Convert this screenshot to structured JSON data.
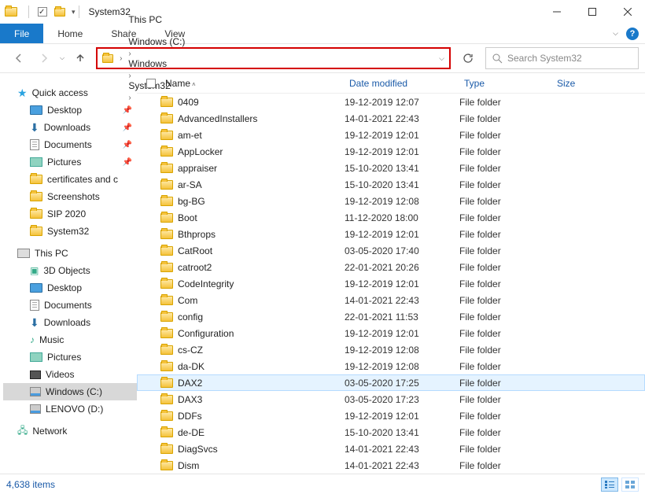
{
  "title": "System32",
  "ribbon": {
    "file": "File",
    "home": "Home",
    "share": "Share",
    "view": "View"
  },
  "breadcrumb": [
    "This PC",
    "Windows (C:)",
    "Windows",
    "System32"
  ],
  "search": {
    "placeholder": "Search System32"
  },
  "columns": {
    "name": "Name",
    "date": "Date modified",
    "type": "Type",
    "size": "Size"
  },
  "tree": {
    "quick": "Quick access",
    "quick_items": [
      {
        "label": "Desktop",
        "icon": "desktop",
        "pin": true
      },
      {
        "label": "Downloads",
        "icon": "download",
        "pin": true
      },
      {
        "label": "Documents",
        "icon": "doc",
        "pin": true
      },
      {
        "label": "Pictures",
        "icon": "pic",
        "pin": true
      },
      {
        "label": "certificates and c",
        "icon": "folder",
        "pin": false
      },
      {
        "label": "Screenshots",
        "icon": "folder",
        "pin": false
      },
      {
        "label": "SIP 2020",
        "icon": "folder",
        "pin": false
      },
      {
        "label": "System32",
        "icon": "folder",
        "pin": false
      }
    ],
    "thispc": "This PC",
    "pc_items": [
      {
        "label": "3D Objects",
        "icon": "3d"
      },
      {
        "label": "Desktop",
        "icon": "desktop"
      },
      {
        "label": "Documents",
        "icon": "doc"
      },
      {
        "label": "Downloads",
        "icon": "download"
      },
      {
        "label": "Music",
        "icon": "music"
      },
      {
        "label": "Pictures",
        "icon": "pic"
      },
      {
        "label": "Videos",
        "icon": "video"
      },
      {
        "label": "Windows (C:)",
        "icon": "disk",
        "selected": true
      },
      {
        "label": "LENOVO (D:)",
        "icon": "disk"
      }
    ],
    "network": "Network"
  },
  "files": [
    {
      "name": "0409",
      "date": "19-12-2019 12:07",
      "type": "File folder"
    },
    {
      "name": "AdvancedInstallers",
      "date": "14-01-2021 22:43",
      "type": "File folder"
    },
    {
      "name": "am-et",
      "date": "19-12-2019 12:01",
      "type": "File folder"
    },
    {
      "name": "AppLocker",
      "date": "19-12-2019 12:01",
      "type": "File folder"
    },
    {
      "name": "appraiser",
      "date": "15-10-2020 13:41",
      "type": "File folder"
    },
    {
      "name": "ar-SA",
      "date": "15-10-2020 13:41",
      "type": "File folder"
    },
    {
      "name": "bg-BG",
      "date": "19-12-2019 12:08",
      "type": "File folder"
    },
    {
      "name": "Boot",
      "date": "11-12-2020 18:00",
      "type": "File folder"
    },
    {
      "name": "Bthprops",
      "date": "19-12-2019 12:01",
      "type": "File folder"
    },
    {
      "name": "CatRoot",
      "date": "03-05-2020 17:40",
      "type": "File folder"
    },
    {
      "name": "catroot2",
      "date": "22-01-2021 20:26",
      "type": "File folder"
    },
    {
      "name": "CodeIntegrity",
      "date": "19-12-2019 12:01",
      "type": "File folder"
    },
    {
      "name": "Com",
      "date": "14-01-2021 22:43",
      "type": "File folder"
    },
    {
      "name": "config",
      "date": "22-01-2021 11:53",
      "type": "File folder"
    },
    {
      "name": "Configuration",
      "date": "19-12-2019 12:01",
      "type": "File folder"
    },
    {
      "name": "cs-CZ",
      "date": "19-12-2019 12:08",
      "type": "File folder"
    },
    {
      "name": "da-DK",
      "date": "19-12-2019 12:08",
      "type": "File folder"
    },
    {
      "name": "DAX2",
      "date": "03-05-2020 17:25",
      "type": "File folder",
      "selected": true
    },
    {
      "name": "DAX3",
      "date": "03-05-2020 17:23",
      "type": "File folder"
    },
    {
      "name": "DDFs",
      "date": "19-12-2019 12:01",
      "type": "File folder"
    },
    {
      "name": "de-DE",
      "date": "15-10-2020 13:41",
      "type": "File folder"
    },
    {
      "name": "DiagSvcs",
      "date": "14-01-2021 22:43",
      "type": "File folder"
    },
    {
      "name": "Dism",
      "date": "14-01-2021 22:43",
      "type": "File folder"
    }
  ],
  "status": {
    "count": "4,638 items"
  }
}
